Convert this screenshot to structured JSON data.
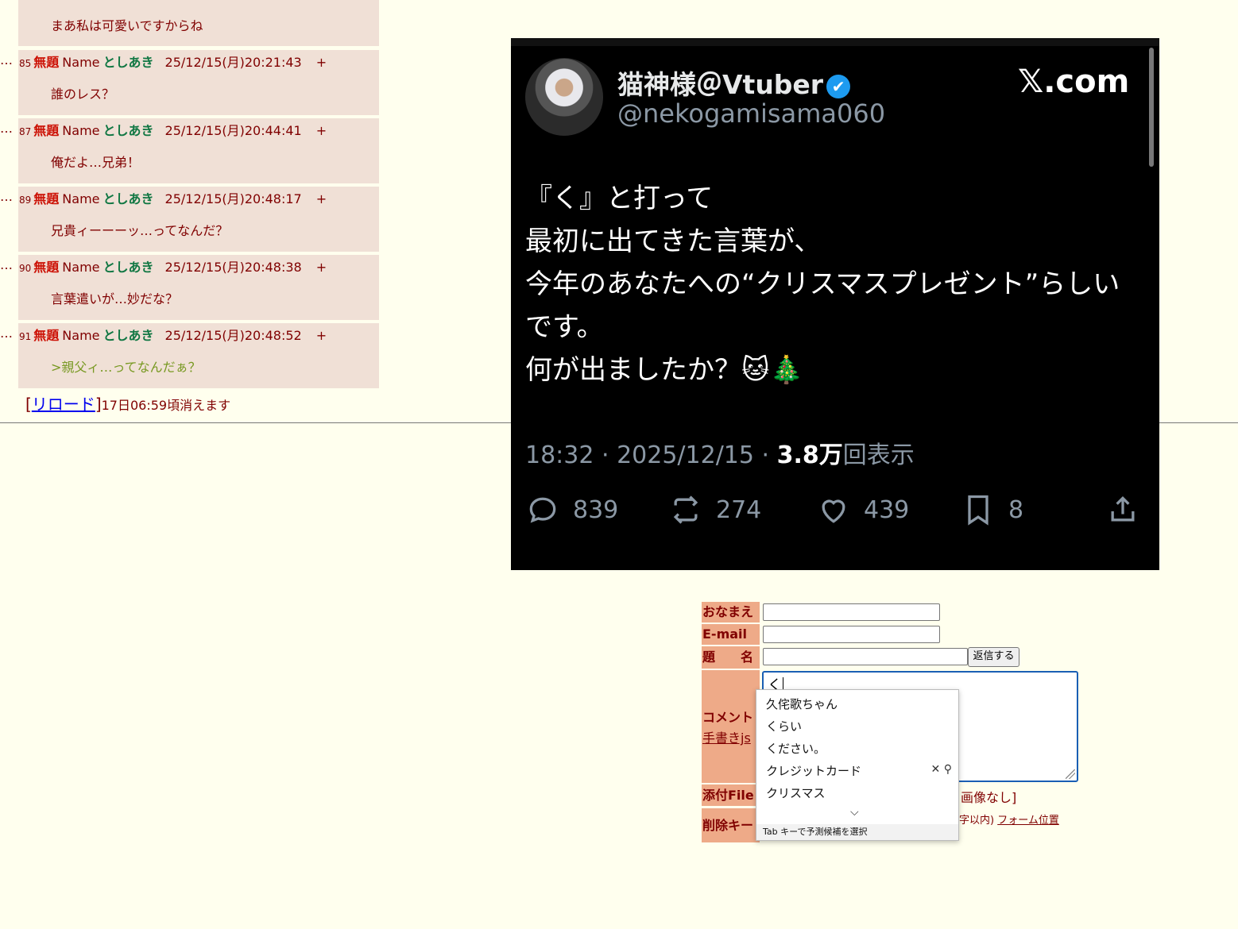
{
  "thread": {
    "first_body": "まあ私は可愛いですからね",
    "replies": [
      {
        "no": "85",
        "subject": "無題",
        "name_label": "Name",
        "name": "としあき",
        "date": "25/12/15(月)20:21:43",
        "plus": "+",
        "body": "誰のレス？",
        "quote": false
      },
      {
        "no": "87",
        "subject": "無題",
        "name_label": "Name",
        "name": "としあき",
        "date": "25/12/15(月)20:44:41",
        "plus": "+",
        "body": "俺だよ…兄弟！",
        "quote": false
      },
      {
        "no": "89",
        "subject": "無題",
        "name_label": "Name",
        "name": "としあき",
        "date": "25/12/15(月)20:48:17",
        "plus": "+",
        "body": "兄貴ィーーーッ…ってなんだ？",
        "quote": false
      },
      {
        "no": "90",
        "subject": "無題",
        "name_label": "Name",
        "name": "としあき",
        "date": "25/12/15(月)20:48:38",
        "plus": "+",
        "body": "言葉遣いが…妙だな？",
        "quote": false
      },
      {
        "no": "91",
        "subject": "無題",
        "name_label": "Name",
        "name": "としあき",
        "date": "25/12/15(月)20:48:52",
        "plus": "+",
        "body": ">親父ィ…ってなんだぁ？",
        "quote": true
      }
    ],
    "dots": "…",
    "reload_open": "[",
    "reload_link": "リロード",
    "reload_close": "]",
    "expire_text": "17日06:59頃消えます"
  },
  "tweet": {
    "display_name": "猫神様＠Vtuber",
    "verified_mark": "✔",
    "handle": "@nekogamisama060",
    "brand": "𝕏.com",
    "lines": [
      "『く』と打って",
      "最初に出てきた言葉が、",
      "今年のあなたへの“クリスマスプレゼント”らしい",
      "です。",
      "何が出ましたか？🐱🎄"
    ],
    "meta_time": "18:32 · 2025/12/15 · ",
    "meta_views_num": "3.8万",
    "meta_views_label": "回表示",
    "replies": "839",
    "retweets": "274",
    "likes": "439",
    "bookmarks": "8"
  },
  "form": {
    "name_label": "おなまえ",
    "email_label": "E-mail",
    "subject_label": "題　　名",
    "submit": "返信する",
    "comment_label": "コメント",
    "handwrite_link": "手書きjs",
    "comment_value": "く",
    "file_label": "添付File",
    "file_after": "画像なし]",
    "delete_label": "削除キー",
    "delete_after": "字以内)",
    "form_pos_link": "フォーム位置"
  },
  "ime": {
    "candidates": [
      "久侘歌ちゃん",
      "くらい",
      "ください。",
      "クレジットカード",
      "クリスマス"
    ],
    "close_glyph": "✕",
    "search_glyph": "⚲",
    "more_glyph": "⌵",
    "footer": "Tab キーで予測候補を選択"
  },
  "colors": {
    "background": "#ffffee",
    "reply_bg": "#f0e0d6",
    "label_bg": "#eeaa88",
    "subject": "#cc1105",
    "name": "#117743",
    "quote": "#789922",
    "tweet_bg": "#000000",
    "verified": "#1d9bf0"
  }
}
